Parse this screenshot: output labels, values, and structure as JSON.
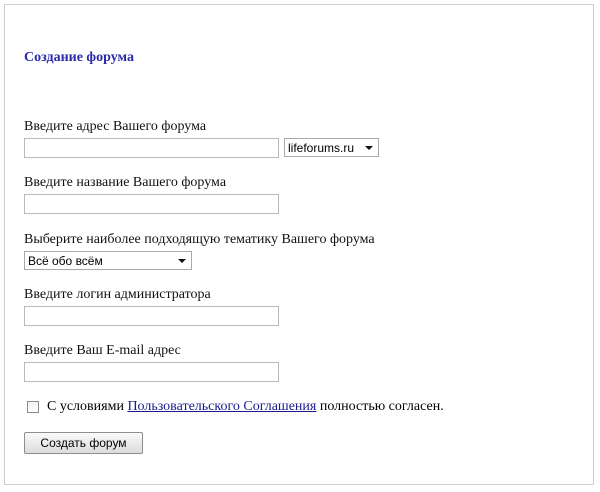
{
  "form": {
    "title": "Создание форума",
    "address_label": "Введите адрес Вашего форума",
    "address_value": "",
    "domain_select": "lifeforums.ru",
    "name_label": "Введите название Вашего форума",
    "name_value": "",
    "topic_label": "Выберите наиболее подходящую тематику Вашего форума",
    "topic_select": "Всё обо всём",
    "login_label": "Введите логин администратора",
    "login_value": "",
    "email_label": "Введите Ваш E-mail адрес",
    "email_value": "",
    "agree_prefix": "С условиями ",
    "agree_link": "Пользовательского Соглашения",
    "agree_suffix": " полностью согласен.",
    "agree_checked": false,
    "submit_label": "Создать форум"
  }
}
